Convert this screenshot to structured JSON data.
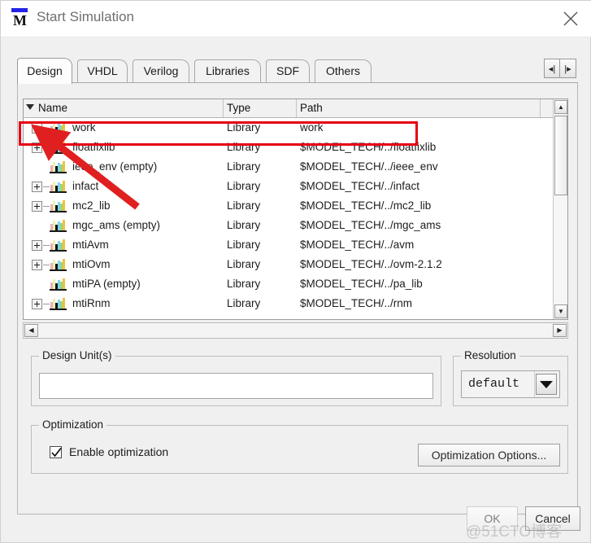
{
  "window": {
    "title": "Start Simulation",
    "logo_icon": "mentor-m-logo",
    "close_icon": "close-icon",
    "accent_color": "#2323e6"
  },
  "tabs": {
    "items": [
      {
        "label": "Design",
        "active": true
      },
      {
        "label": "VHDL",
        "active": false
      },
      {
        "label": "Verilog",
        "active": false
      },
      {
        "label": "Libraries",
        "active": false
      },
      {
        "label": "SDF",
        "active": false
      },
      {
        "label": "Others",
        "active": false
      }
    ],
    "nav_prev_icon": "chevron-left-icon",
    "nav_next_icon": "chevron-right-icon",
    "nav_prev_glyph": "◂|",
    "nav_next_glyph": "|▸"
  },
  "library_list": {
    "columns": [
      "Name",
      "Type",
      "Path"
    ],
    "sort_indicator": "sort-descending-icon",
    "rows": [
      {
        "name": "work",
        "type": "Library",
        "path": "work",
        "expandable": true,
        "highlighted": true
      },
      {
        "name": "floatfixlib",
        "type": "Library",
        "path": "$MODEL_TECH/../floatfixlib",
        "expandable": true,
        "highlighted": false
      },
      {
        "name": "ieee_env  (empty)",
        "type": "Library",
        "path": "$MODEL_TECH/../ieee_env",
        "expandable": false,
        "highlighted": false
      },
      {
        "name": "infact",
        "type": "Library",
        "path": "$MODEL_TECH/../infact",
        "expandable": true,
        "highlighted": false
      },
      {
        "name": "mc2_lib",
        "type": "Library",
        "path": "$MODEL_TECH/../mc2_lib",
        "expandable": true,
        "highlighted": false
      },
      {
        "name": "mgc_ams  (empty)",
        "type": "Library",
        "path": "$MODEL_TECH/../mgc_ams",
        "expandable": false,
        "highlighted": false
      },
      {
        "name": "mtiAvm",
        "type": "Library",
        "path": "$MODEL_TECH/../avm",
        "expandable": true,
        "highlighted": false
      },
      {
        "name": "mtiOvm",
        "type": "Library",
        "path": "$MODEL_TECH/../ovm-2.1.2",
        "expandable": true,
        "highlighted": false
      },
      {
        "name": "mtiPA  (empty)",
        "type": "Library",
        "path": "$MODEL_TECH/../pa_lib",
        "expandable": false,
        "highlighted": false
      },
      {
        "name": "mtiRnm",
        "type": "Library",
        "path": "$MODEL_TECH/../rnm",
        "expandable": true,
        "highlighted": false
      }
    ],
    "vscroll": {
      "up_icon": "scroll-up-icon",
      "down_icon": "scroll-down-icon",
      "up_glyph": "▲",
      "down_glyph": "▼"
    },
    "hscroll": {
      "left_icon": "scroll-left-icon",
      "right_icon": "scroll-right-icon",
      "left_glyph": "◀",
      "right_glyph": "▶"
    }
  },
  "design_units": {
    "group_label": "Design Unit(s)",
    "value": "",
    "placeholder": ""
  },
  "resolution": {
    "group_label": "Resolution",
    "selected": "default",
    "dropdown_icon": "chevron-down-icon"
  },
  "optimization": {
    "group_label": "Optimization",
    "checkbox_label": "Enable optimization",
    "checked": true,
    "check_icon": "checkmark-icon",
    "options_button": "Optimization Options..."
  },
  "footer": {
    "ok_label": "OK",
    "cancel_label": "Cancel"
  },
  "annotations": {
    "highlight_color": "#e60012",
    "highlight_target": "work-library-row",
    "arrow_target": "expander-work",
    "watermark": "@51CTO博客"
  }
}
